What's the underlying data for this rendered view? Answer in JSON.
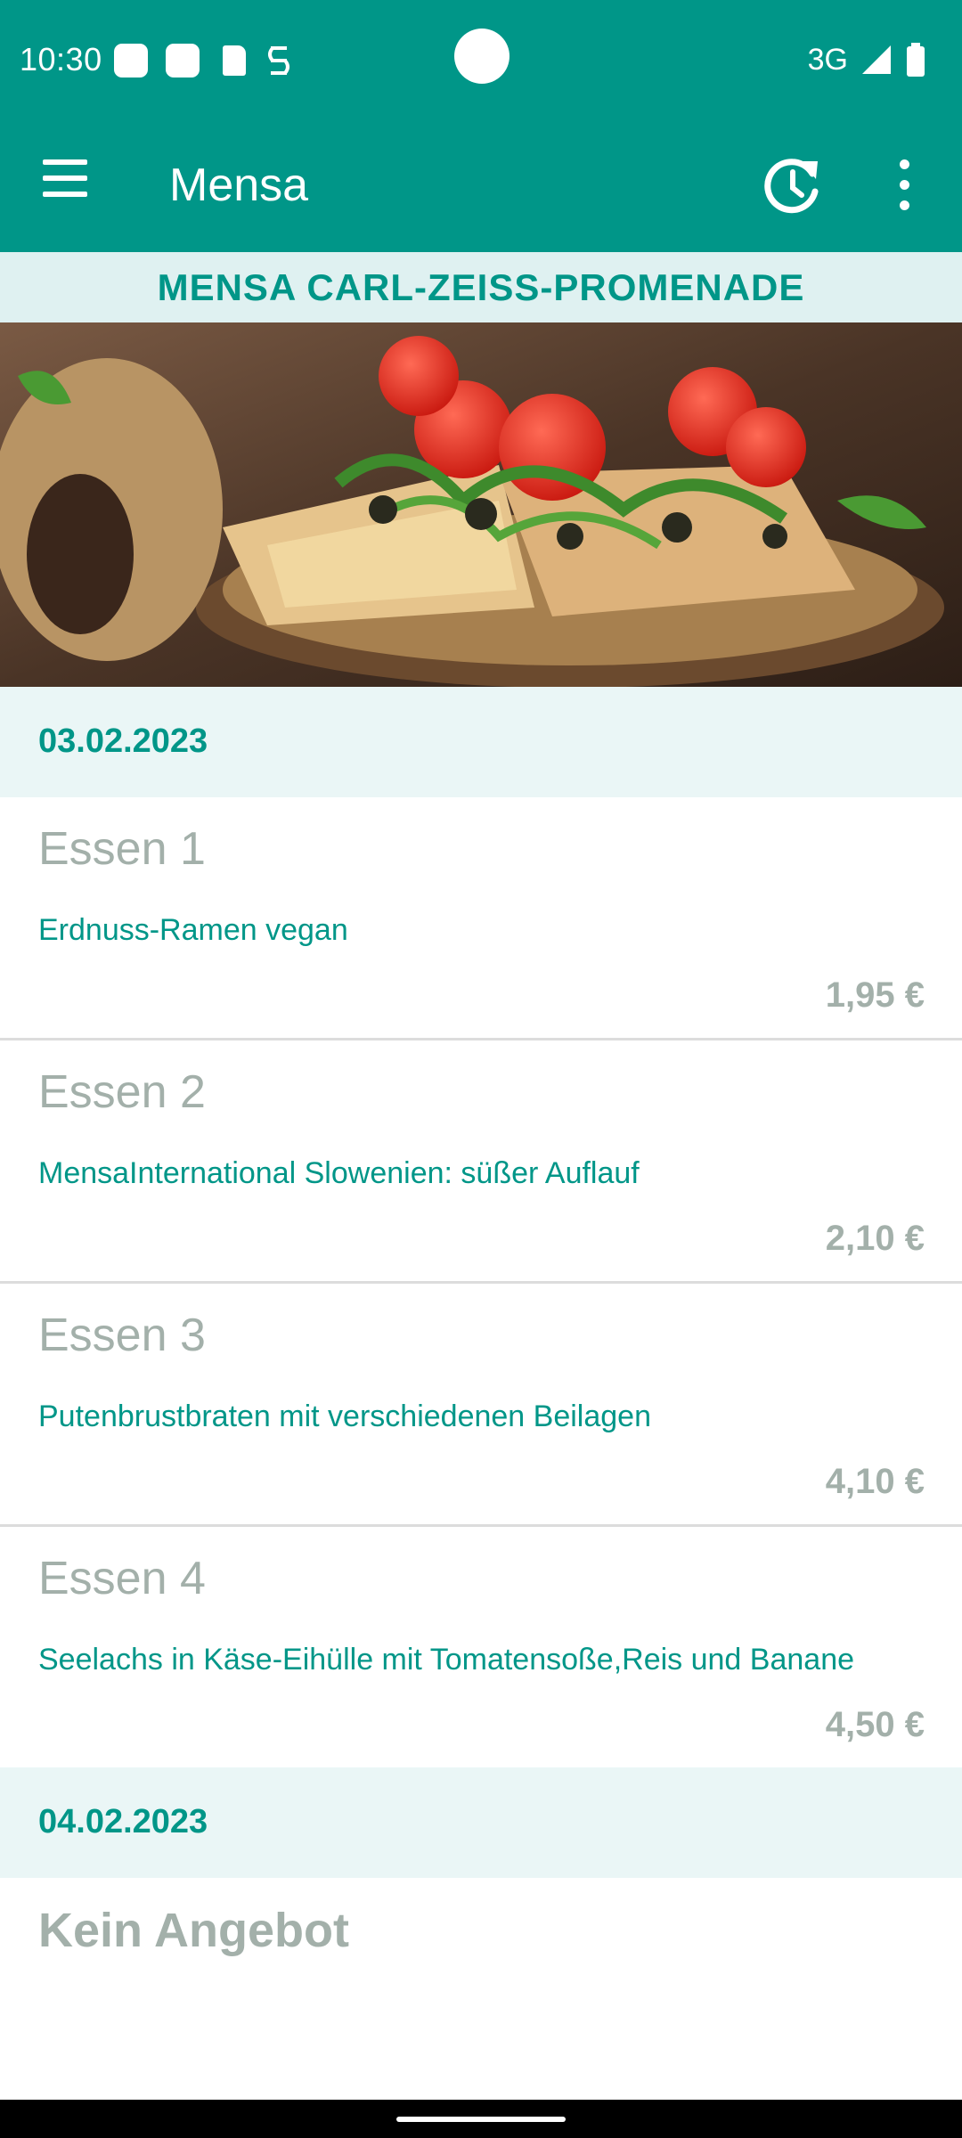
{
  "status_bar": {
    "time": "10:30",
    "network": "3G",
    "icons": [
      "notification-icon",
      "notification-icon",
      "sd-card-icon",
      "gesture-icon",
      "signal-icon",
      "battery-icon"
    ]
  },
  "app_bar": {
    "title": "Mensa",
    "menu_icon": "hamburger-menu-icon",
    "refresh_icon": "history-refresh-icon",
    "more_icon": "more-vert-icon"
  },
  "mensa_header": "MENSA CARL-ZEISS-PROMENADE",
  "days": [
    {
      "date": "03.02.2023",
      "meals": [
        {
          "title": "Essen 1",
          "description": "Erdnuss-Ramen vegan",
          "price": "1,95 €"
        },
        {
          "title": "Essen 2",
          "description": "MensaInternational Slowenien: süßer Auflauf",
          "price": "2,10 €"
        },
        {
          "title": "Essen 3",
          "description": "Putenbrustbraten mit verschiedenen Beilagen",
          "price": "4,10 €"
        },
        {
          "title": "Essen 4",
          "description": "Seelachs in Käse-Eihülle mit Tomatensoße,Reis und Banane",
          "price": "4,50 €"
        }
      ]
    },
    {
      "date": "04.02.2023",
      "no_offer": "Kein Angebot"
    }
  ],
  "colors": {
    "primary": "#009688",
    "header_bg": "#dff1f1",
    "date_bg": "#eaf6f6",
    "muted_text": "#a3b0aa"
  }
}
